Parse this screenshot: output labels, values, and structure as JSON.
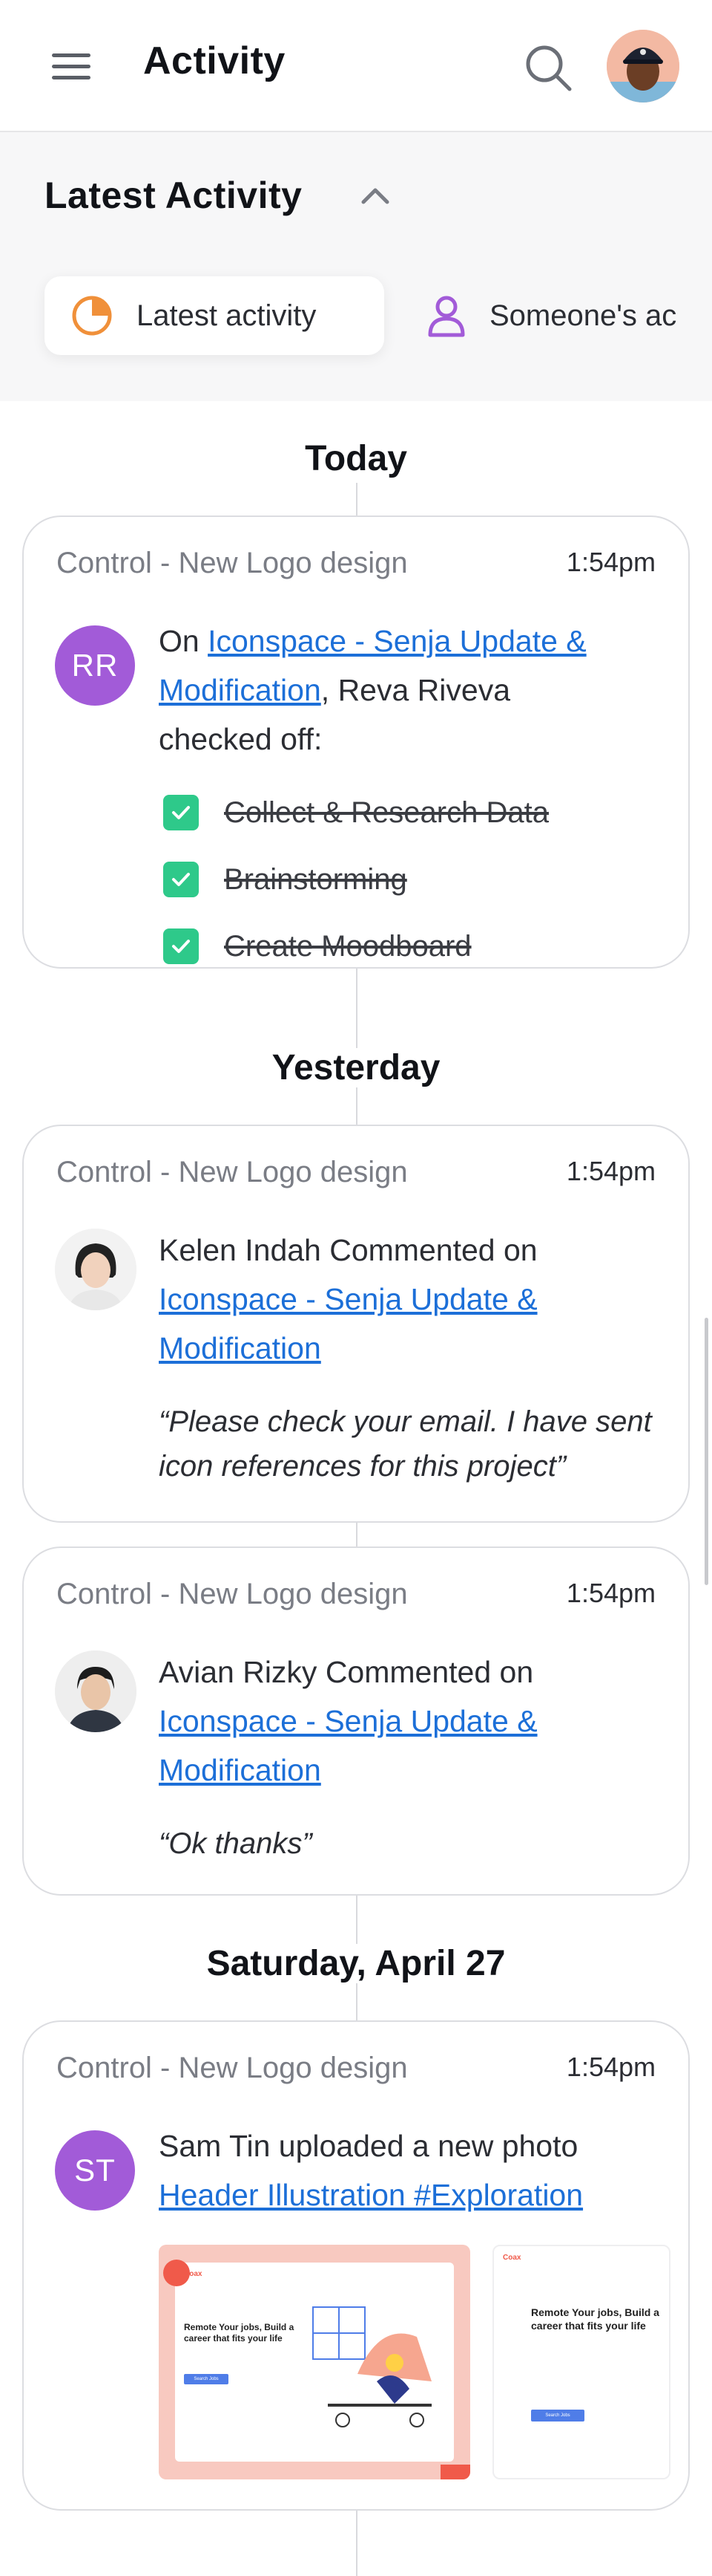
{
  "header": {
    "title": "Activity",
    "menu_icon": "hamburger-menu-icon",
    "search_icon": "search-icon"
  },
  "filter": {
    "title": "Latest Activity",
    "chips": [
      {
        "label": "Latest activity",
        "icon": "pie-chart-icon",
        "color": "#f0903a"
      },
      {
        "label": "Someone's ac",
        "icon": "person-icon",
        "color": "#a25bd8"
      }
    ]
  },
  "days": {
    "d1": "Today",
    "d2": "Yesterday",
    "d3": "Saturday, April 27"
  },
  "cards": [
    {
      "project": "Control - New Logo design",
      "time": "1:54pm",
      "initials": "RR",
      "prefix": "On ",
      "link1": "Iconspace - Senja Update &",
      "link2": "Modification",
      "suffix": ", Reva Riveva",
      "line3": "checked off:",
      "checklist": [
        "Collect & Research Data",
        "Brainstorming",
        "Create Moodboard"
      ]
    },
    {
      "project": "Control - New Logo design",
      "time": "1:54pm",
      "actor_line": "Kelen Indah Commented on",
      "link1": "Iconspace - Senja Update &",
      "link2": "Modification",
      "quote": "“Please check your email. I have sent icon references for this project”"
    },
    {
      "project": "Control - New Logo design",
      "time": "1:54pm",
      "actor_line": "Avian Rizky Commented on",
      "link1": "Iconspace - Senja Update &",
      "link2": "Modification",
      "quote": "“Ok thanks”"
    },
    {
      "project": "Control - New Logo design",
      "time": "1:54pm",
      "initials": "ST",
      "actor_line": "Sam Tin uploaded a new photo",
      "link1": "Header Illustration #Exploration",
      "thumbs": [
        {
          "brand": "Coax",
          "headline": "Remote Your jobs, Build a career that fits your life",
          "cta": "Search Jobs",
          "bg": "#f8c9c0"
        },
        {
          "brand": "Coax",
          "headline": "Remote Your jobs, Build a career that fits your life",
          "cta": "Search Jobs",
          "bg": "#ffffff"
        }
      ]
    }
  ]
}
